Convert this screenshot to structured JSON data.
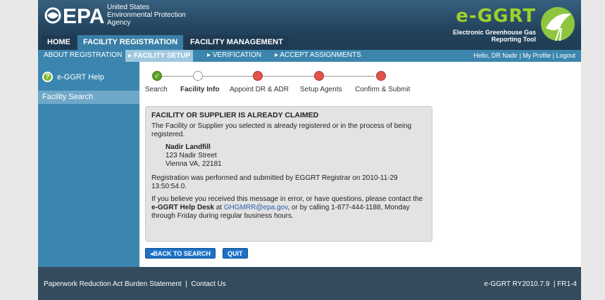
{
  "header": {
    "agency_line1": "United States",
    "agency_line2": "Environmental Protection",
    "agency_line3": "Agency",
    "logo_text": "EPA",
    "app_title": "e-GGRT",
    "app_subtitle_line1": "Electronic Greenhouse Gas",
    "app_subtitle_line2": "Reporting Tool"
  },
  "tabs": [
    {
      "label": "HOME"
    },
    {
      "label": "FACILITY REGISTRATION"
    },
    {
      "label": "FACILITY MANAGEMENT"
    }
  ],
  "subnav": {
    "items": [
      {
        "label": "ABOUT REGISTRATION"
      },
      {
        "label": "FACILITY SETUP"
      },
      {
        "label": "VERIFICATION"
      },
      {
        "label": "ACCEPT ASSIGNMENTS"
      }
    ],
    "hello": "Hello, DR Nadir",
    "my_profile": "My Profile",
    "logout": "Logout"
  },
  "sidebar": {
    "help_label": "e-GGRT Help",
    "items": [
      {
        "label": "Facility Search"
      }
    ]
  },
  "steps": [
    {
      "label": "Search",
      "state": "done"
    },
    {
      "label": "Facility Info",
      "state": "current"
    },
    {
      "label": "Appoint DR & ADR",
      "state": "todo"
    },
    {
      "label": "Setup Agents",
      "state": "todo"
    },
    {
      "label": "Confirm & Submit",
      "state": "todo"
    }
  ],
  "notice": {
    "title": "FACILITY OR SUPPLIER IS ALREADY CLAIMED",
    "intro": "The Facility or Supplier you selected is already registered or in the process of being registered.",
    "facility_name": "Nadir Landfill",
    "address_line1": "123 Nadir Street",
    "address_line2": "Vienna VA, 22181",
    "registration_text": "Registration was performed and submitted by EGGRT Registrar on 2010-11-29 13:50:54.0.",
    "contact_pre": "If you believe you received this message in error, or have questions, please contact the ",
    "help_desk": "e-GGRT Help Desk",
    "contact_mid": " at ",
    "email": "GHGMRR@epa.gov",
    "contact_post": ", or by calling 1-877-444-1188, Monday through Friday during regular business hours."
  },
  "buttons": {
    "back": "BACK TO SEARCH",
    "quit": "QUIT"
  },
  "footer": {
    "paperwork": "Paperwork Reduction Act Burden Statement",
    "contact": "Contact Us",
    "version": "e-GGRT RY2010.7.9",
    "screen_id": "FR1-4"
  },
  "colors": {
    "header_bg": "#23435c",
    "tab_active": "#3a7fa7",
    "subnav_bg": "#3c86ae",
    "sidebar_bg": "#3b86b0",
    "step_done": "#5ca12a",
    "step_todo": "#e0524a",
    "button_bg": "#1d72c8",
    "app_title_color": "#9ed12a"
  }
}
